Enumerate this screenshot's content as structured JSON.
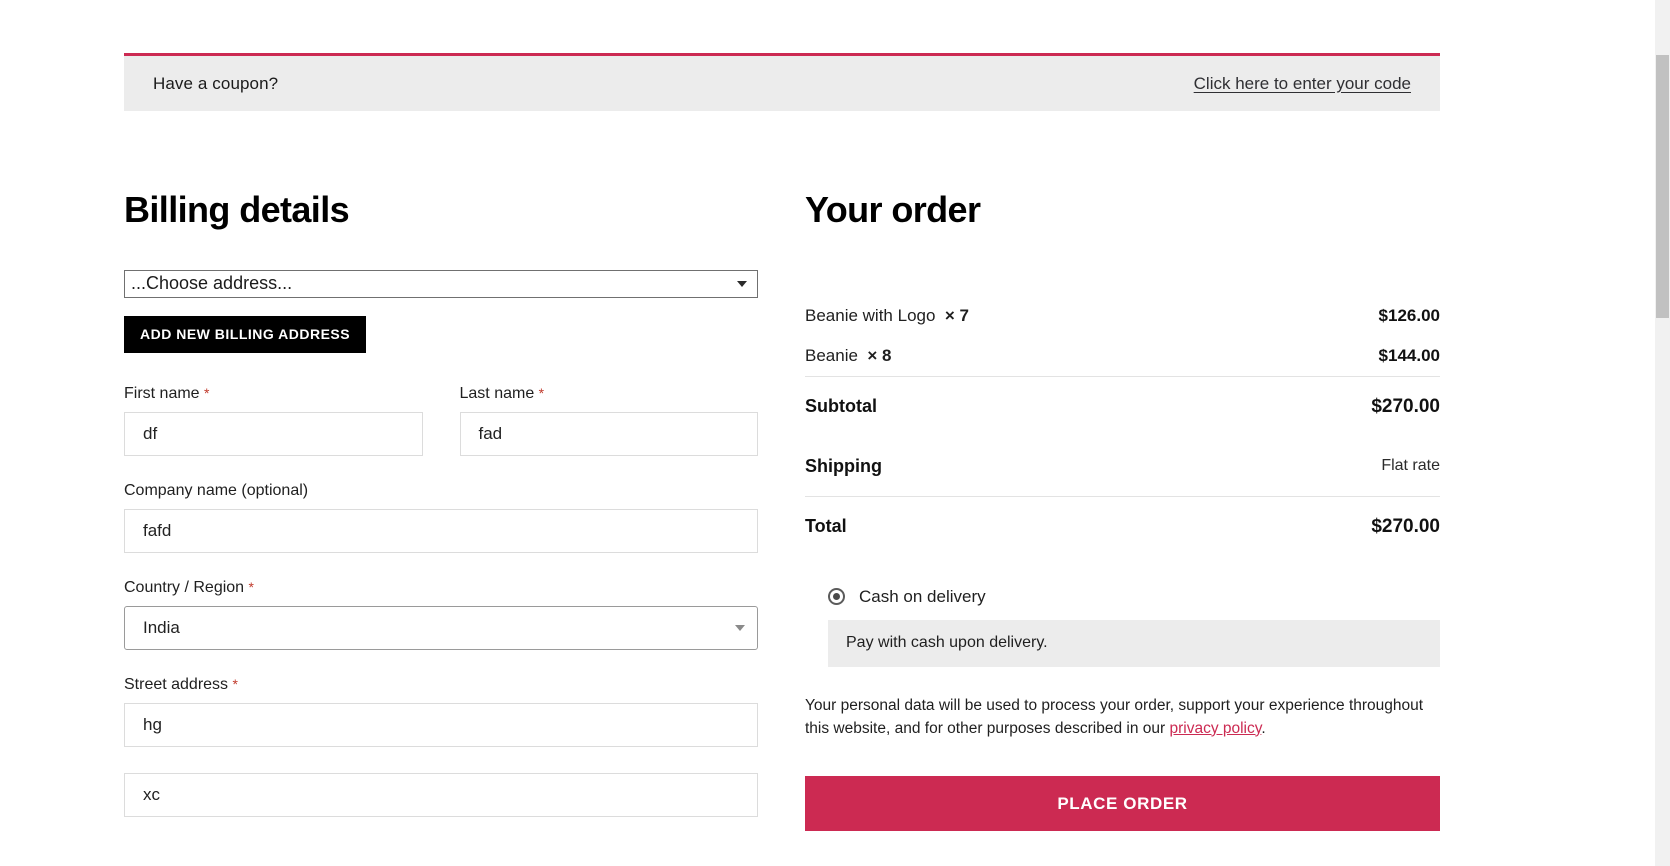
{
  "coupon": {
    "prompt": "Have a coupon?",
    "link": "Click here to enter your code",
    "accent_color": "#cc2a52",
    "bar_bg": "#ececec"
  },
  "billing": {
    "title": "Billing details",
    "address_select": {
      "selected": "...Choose address...",
      "icon": "chevron-down-icon"
    },
    "add_address_button": "ADD NEW BILLING ADDRESS",
    "fields": {
      "first_name": {
        "label": "First name",
        "required": "*",
        "value": "df"
      },
      "last_name": {
        "label": "Last name",
        "required": "*",
        "value": "fad"
      },
      "company": {
        "label": "Company name (optional)",
        "required": "",
        "value": "fafd"
      },
      "country": {
        "label": "Country / Region",
        "required": "*",
        "value": "India"
      },
      "street": {
        "label": "Street address",
        "required": "*",
        "value": "hg"
      },
      "street2": {
        "label": "",
        "required": "",
        "value": "xc"
      }
    }
  },
  "order": {
    "title": "Your order",
    "items": [
      {
        "name": "Beanie with Logo",
        "qty": "× 7",
        "price": "$126.00"
      },
      {
        "name": "Beanie",
        "qty": "× 8",
        "price": "$144.00"
      }
    ],
    "subtotal": {
      "label": "Subtotal",
      "value": "$270.00"
    },
    "shipping": {
      "label": "Shipping",
      "value": "Flat rate"
    },
    "total": {
      "label": "Total",
      "value": "$270.00"
    },
    "payment": {
      "method_label": "Cash on delivery",
      "method_description": "Pay with cash upon delivery.",
      "selected": true
    },
    "privacy_text_before": "Your personal data will be used to process your order, support your experience throughout this website, and for other purposes described in our ",
    "privacy_link": "privacy policy",
    "privacy_text_after": ".",
    "place_order_button": "PLACE ORDER",
    "button_color": "#cc2a52"
  }
}
